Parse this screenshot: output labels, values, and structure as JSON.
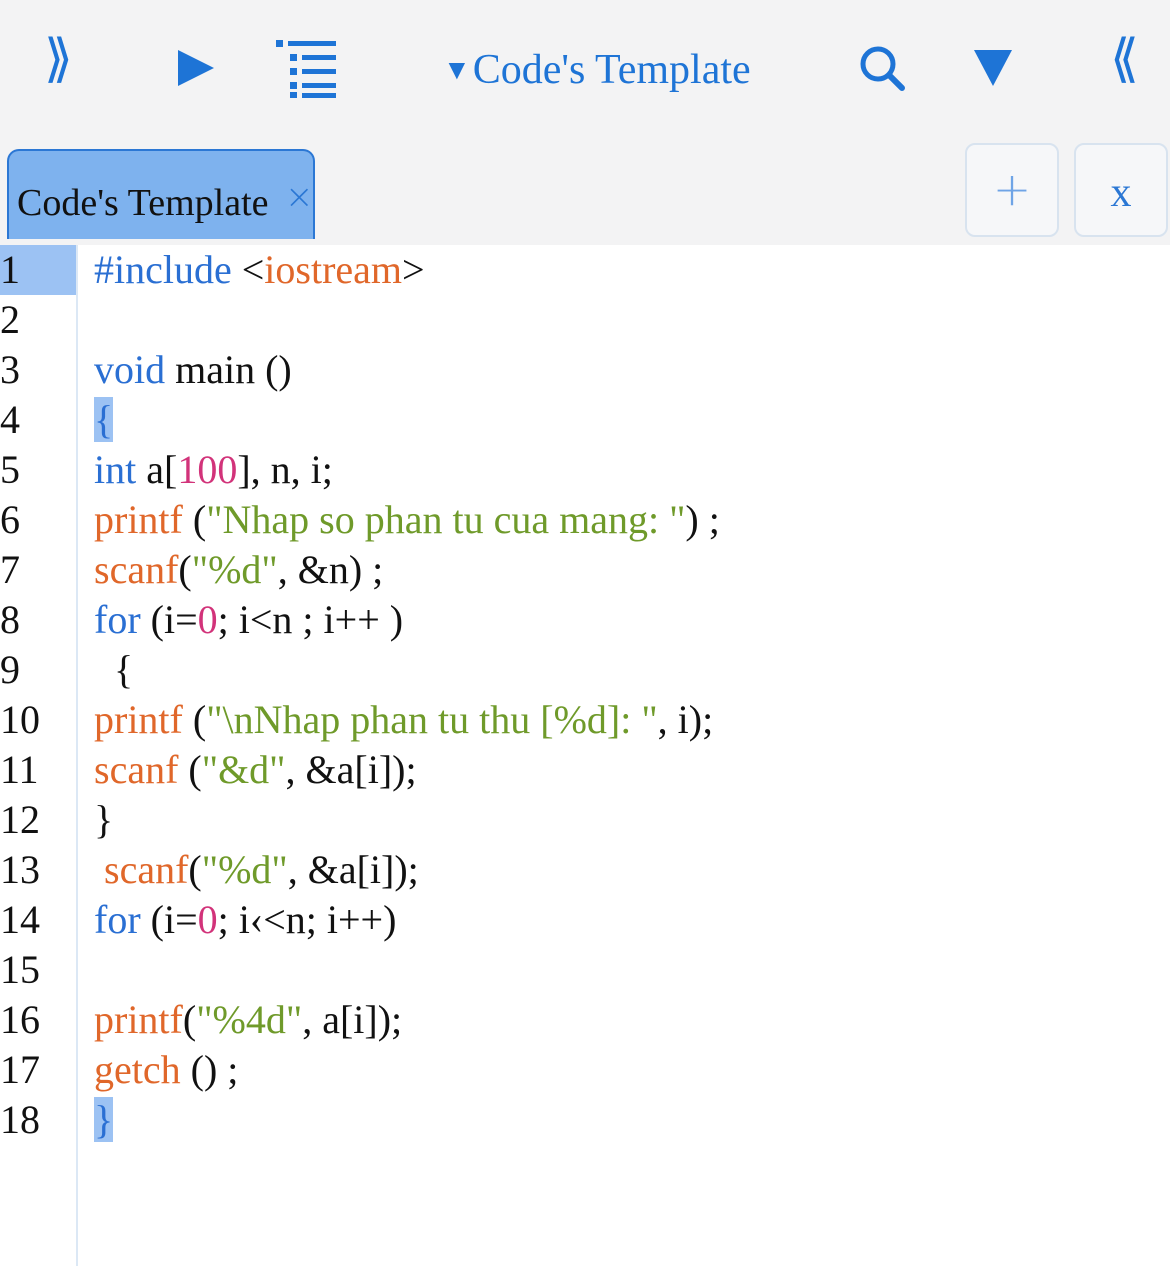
{
  "toolbar": {
    "title": "Code's Template",
    "expand_glyph": "⟫",
    "collapse_glyph": "⟪",
    "icons": [
      "expand-icon",
      "play-icon",
      "outline-list-icon",
      "search-icon",
      "filter-icon",
      "collapse-icon"
    ],
    "accent_color": "#1e74d6"
  },
  "tabs": {
    "active_label": "Code's Template",
    "close_glyph": "×",
    "add_label": "+",
    "close_all_label": "x"
  },
  "editor": {
    "active_line": 1,
    "line_numbers": [
      "1",
      "2",
      "3",
      "4",
      "5",
      "6",
      "7",
      "8",
      "9",
      "10",
      "11",
      "12",
      "13",
      "14",
      "15",
      "16",
      "17",
      "18"
    ],
    "lines": [
      "#include <iostream>",
      "",
      "void main ()",
      "{",
      "int a[100], n, i;",
      "printf (\"Nhap so phan tu cua mang: \") ;",
      "scanf(\"%d\", &n) ;",
      "for (i=0; i<n ; i++ )",
      "  {",
      "printf (\"\\nNhap phan tu thu [%d]: \", i);",
      "scanf (\"&d\", &a[i]);",
      "}",
      " scanf(\"%d\", &a[i]);",
      "for (i=0; i‹<n; i++)",
      "",
      "printf(\"%4d\", a[i]);",
      "getch () ;",
      "}"
    ],
    "syntax_colors": {
      "keyword": "#2a6fd3",
      "function": "#e0672a",
      "string": "#6f9a2a",
      "number": "#d2337a",
      "highlight": "#9cc2f3"
    }
  }
}
